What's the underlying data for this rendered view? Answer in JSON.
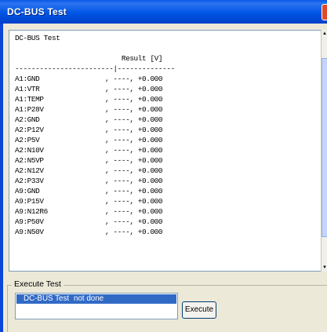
{
  "window": {
    "title": "DC-BUS Test"
  },
  "console": {
    "lines": [
      "DC-BUS Test",
      "",
      "                          Result [V]",
      "------------------------|--------------",
      "A1:GND                , ----, +0.000",
      "A1:VTR                , ----, +0.000",
      "A1:TEMP               , ----, +0.000",
      "A1:P28V               , ----, +0.000",
      "A2:GND                , ----, +0.000",
      "A2:P12V               , ----, +0.000",
      "A2:P5V                , ----, +0.000",
      "A2:N10V               , ----, +0.000",
      "A2:N5VP               , ----, +0.000",
      "A2:N12V               , ----, +0.000",
      "A2:P33V               , ----, +0.000",
      "A9:GND                , ----, +0.000",
      "A9:P15V               , ----, +0.000",
      "A9:N12R6              , ----, +0.000",
      "A9:P50V               , ----, +0.000",
      "A9:N50V               , ----, +0.000"
    ]
  },
  "execute_test": {
    "group_label": "Execute Test",
    "items": [
      {
        "name": "DC-BUS Test",
        "status": "not done"
      }
    ],
    "execute_label": "Execute"
  },
  "icons": {
    "close": "close-icon",
    "scroll_up": "scroll-up-arrow-icon",
    "scroll_down": "scroll-down-arrow-icon"
  },
  "colors": {
    "title_bar": "#0055e5",
    "selection": "#316ac5"
  }
}
